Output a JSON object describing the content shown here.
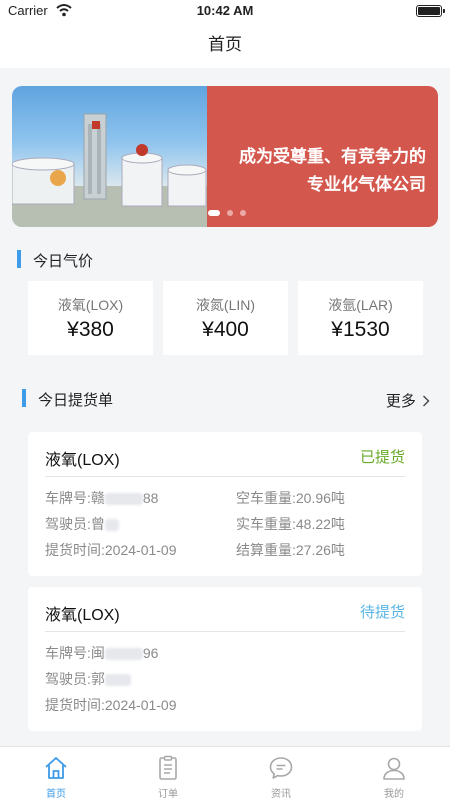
{
  "status_bar": {
    "carrier": "Carrier",
    "time": "10:42 AM"
  },
  "nav": {
    "title": "首页"
  },
  "banner": {
    "slogan_line1": "成为受尊重、有竞争力的",
    "slogan_line2": "专业化气体公司",
    "page_count": 3,
    "active_index": 0
  },
  "prices": {
    "title": "今日气价",
    "items": [
      {
        "name": "液氧(LOX)",
        "value": "¥380"
      },
      {
        "name": "液氮(LIN)",
        "value": "¥400"
      },
      {
        "name": "液氩(LAR)",
        "value": "¥1530"
      }
    ]
  },
  "orders": {
    "title": "今日提货单",
    "more_label": "更多",
    "items": [
      {
        "product": "液氧(LOX)",
        "status": "已提货",
        "status_color": "#6aaa2a",
        "plate_label": "车牌号:",
        "plate_prefix": "赣",
        "plate_suffix": "88",
        "driver_label": "驾驶员:",
        "driver_prefix": "曾",
        "date_label": "提货时间:",
        "date": "2024-01-09",
        "empty_weight": "空车重量:20.96吨",
        "loaded_weight": "实车重量:48.22吨",
        "settle_weight": "结算重量:27.26吨"
      },
      {
        "product": "液氧(LOX)",
        "status": "待提货",
        "status_color": "#5ab6e6",
        "plate_label": "车牌号:",
        "plate_prefix": "闽",
        "plate_suffix": "96",
        "driver_label": "驾驶员:",
        "driver_prefix": "郭",
        "date_label": "提货时间:",
        "date": "2024-01-09"
      }
    ]
  },
  "tabbar": {
    "active_color": "#3d9be8",
    "items": [
      {
        "label": "首页",
        "icon": "home-icon",
        "active": true
      },
      {
        "label": "订单",
        "icon": "clipboard-icon",
        "active": false
      },
      {
        "label": "资讯",
        "icon": "chat-bubble-icon",
        "active": false
      },
      {
        "label": "我的",
        "icon": "user-icon",
        "active": false
      }
    ]
  }
}
